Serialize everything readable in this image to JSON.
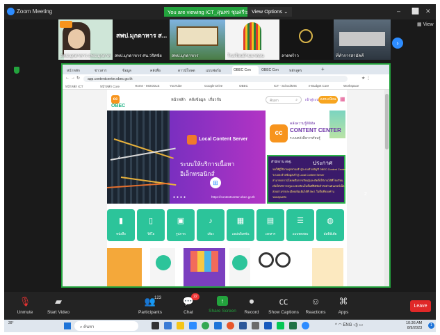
{
  "zoom": {
    "window_title": "Zoom Meeting",
    "viewing_label": "You are viewing ICT_สุนทร ชุมศรี's screen",
    "view_options_label": "View Options",
    "view_label": "View",
    "next_icon": "chevron-right-icon",
    "thumbnails": [
      {
        "name": "สพป.มุกดาหาร ส...",
        "label": "สพป.มุกดาหาร สพป.มุกดาหาร ส..."
      },
      {
        "name": "สพป.มุกดาหาร ศน.วริศชัย",
        "label": "สพป.มุกดาหาร ศน.วริศชัย"
      },
      {
        "name": "สพป.มุกดาหาร",
        "label": "สพป.มุกดาหาร"
      },
      {
        "name": "โรงเรียนบ้านนาดอน",
        "label": "โรงเรียนบ้านนาดอน"
      },
      {
        "name": "ลาดพร้าว",
        "label": "ลาดพร้าว"
      },
      {
        "name": "ที่ทำการสามัคคี",
        "label": "ที่ทำการสามัคคี"
      }
    ],
    "toolbar": {
      "unmute": "Unmute",
      "start_video": "Start Video",
      "participants": "Participants",
      "participant_count": "123",
      "chat": "Chat",
      "chat_badge": "22",
      "share_screen": "Share Screen",
      "record": "Record",
      "show_captions": "Show Captions",
      "reactions": "Reactions",
      "apps": "Apps",
      "leave": "Leave"
    }
  },
  "browser": {
    "tabs": [
      "หน้าหลัก",
      "ข่าวสาร",
      "ข้อมูล",
      "คลังสื่อ",
      "ดาวน์โหลด",
      "แบบฟอร์ม",
      "OBEC Con",
      "OBEC Con",
      "หลักสูตร"
    ],
    "url": "app.contentcenter.obec.go.th",
    "bookmarks": [
      "หน้าหลัก ICT",
      "หน้าหลัก Core",
      "Home - MOODLE",
      "YouTube",
      "Google Drive",
      "OBEC",
      "ICT - SchoolMIS",
      "e-Budget Core",
      "Workspace"
    ]
  },
  "site": {
    "logo_text": "OBEC",
    "nav": [
      "หน้าหลัก",
      "คลังข้อมูล",
      "เกี่ยวกับ"
    ],
    "search_placeholder": "ค้นหา",
    "login": "เข้าสู่ระบบ",
    "register": "ลงทะเบียน",
    "banner_title": "Local Content Server",
    "banner_subtitle": "ระบบให้บริการเนื้อหาอิเล็กทรอนิกส์",
    "banner_url": "https://contentcenter.obec.go.th",
    "cc_thai": "คลังความรู้ดิจิทัล",
    "cc_title": "CONTENT CENTER",
    "cc_sub": "ระบบคลังสื่อการเรียนรู้",
    "announce_org": "สำนักงาน สพฐ.",
    "announce_title": "ประกาศ",
    "announce_lines": [
      "ขอให้ผู้ใช้งานทุกท่านเข้าสู่ระบบด้วยบัญชี OBEC Content Center",
      "ระบบจะย้ายข้อมูลเข้าสู่ Local Content Server",
      "สามารถดาวน์โหลดสื่อการเรียนรู้และติดตั้งใช้งานได้ที่โรงเรียน",
      "เพื่อให้บริการครูและนักเรียนในพื้นที่ที่มีข้อจำกัดด้านอินเทอร์เน็ต",
      "สอบถามรายละเอียดเพิ่มเติมได้ที่ สพป. ในพื้นที่ของท่าน",
      "ขอบคุณครับ"
    ],
    "categories": [
      {
        "label": "หนังสือ",
        "icon": "book-icon"
      },
      {
        "label": "วีดีโอ",
        "icon": "video-icon"
      },
      {
        "label": "รูปภาพ",
        "icon": "image-icon"
      },
      {
        "label": "เสียง",
        "icon": "music-icon"
      },
      {
        "label": "แอปพลิเคชัน",
        "icon": "apps-icon"
      },
      {
        "label": "เอกสาร",
        "icon": "document-icon"
      },
      {
        "label": "แบบทดสอบ",
        "icon": "quiz-icon"
      },
      {
        "label": "มัลติมีเดีย",
        "icon": "multimedia-icon"
      }
    ],
    "page_number": "2"
  },
  "taskbar": {
    "weather_temp": "28°",
    "weather_text": "",
    "search_placeholder": "ค้นหา",
    "lang": "ENG",
    "time": "10:36 AM",
    "date": "8/9/2023",
    "notification_count": "1"
  }
}
